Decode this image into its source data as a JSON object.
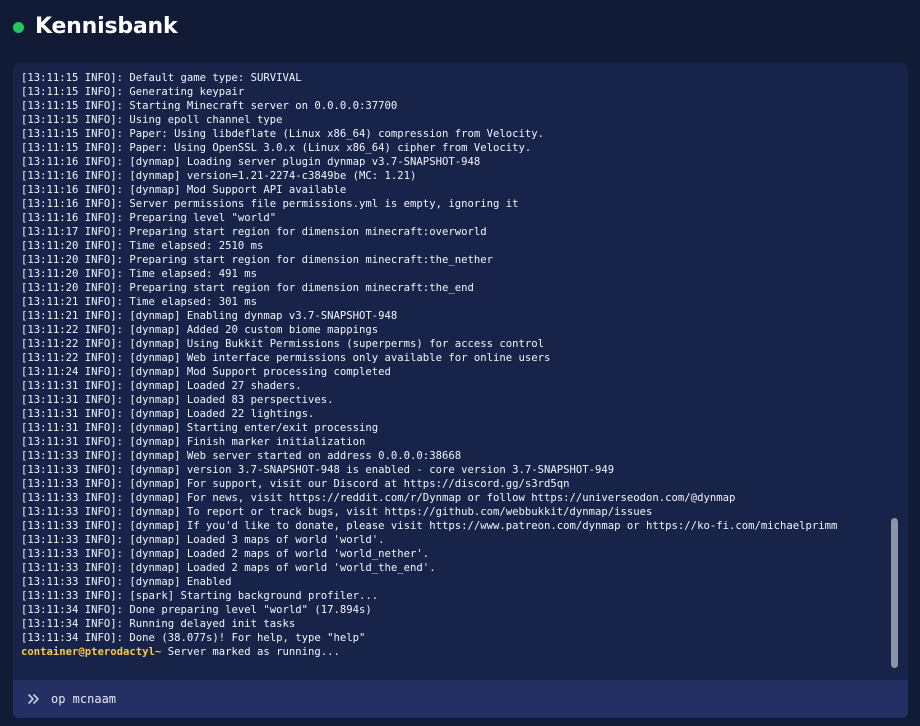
{
  "header": {
    "server_name": "Kennisbank",
    "status_color": "#22c55e"
  },
  "console": {
    "lines": [
      "[13:11:15 INFO]: Default game type: SURVIVAL",
      "[13:11:15 INFO]: Generating keypair",
      "[13:11:15 INFO]: Starting Minecraft server on 0.0.0.0:37700",
      "[13:11:15 INFO]: Using epoll channel type",
      "[13:11:15 INFO]: Paper: Using libdeflate (Linux x86_64) compression from Velocity.",
      "[13:11:15 INFO]: Paper: Using OpenSSL 3.0.x (Linux x86_64) cipher from Velocity.",
      "[13:11:16 INFO]: [dynmap] Loading server plugin dynmap v3.7-SNAPSHOT-948",
      "[13:11:16 INFO]: [dynmap] version=1.21-2274-c3849be (MC: 1.21)",
      "[13:11:16 INFO]: [dynmap] Mod Support API available",
      "[13:11:16 INFO]: Server permissions file permissions.yml is empty, ignoring it",
      "[13:11:16 INFO]: Preparing level \"world\"",
      "[13:11:17 INFO]: Preparing start region for dimension minecraft:overworld",
      "[13:11:20 INFO]: Time elapsed: 2510 ms",
      "[13:11:20 INFO]: Preparing start region for dimension minecraft:the_nether",
      "[13:11:20 INFO]: Time elapsed: 491 ms",
      "[13:11:20 INFO]: Preparing start region for dimension minecraft:the_end",
      "[13:11:21 INFO]: Time elapsed: 301 ms",
      "[13:11:21 INFO]: [dynmap] Enabling dynmap v3.7-SNAPSHOT-948",
      "[13:11:22 INFO]: [dynmap] Added 20 custom biome mappings",
      "[13:11:22 INFO]: [dynmap] Using Bukkit Permissions (superperms) for access control",
      "[13:11:22 INFO]: [dynmap] Web interface permissions only available for online users",
      "[13:11:24 INFO]: [dynmap] Mod Support processing completed",
      "[13:11:31 INFO]: [dynmap] Loaded 27 shaders.",
      "[13:11:31 INFO]: [dynmap] Loaded 83 perspectives.",
      "[13:11:31 INFO]: [dynmap] Loaded 22 lightings.",
      "[13:11:31 INFO]: [dynmap] Starting enter/exit processing",
      "[13:11:31 INFO]: [dynmap] Finish marker initialization",
      "[13:11:33 INFO]: [dynmap] Web server started on address 0.0.0.0:38668",
      "[13:11:33 INFO]: [dynmap] version 3.7-SNAPSHOT-948 is enabled - core version 3.7-SNAPSHOT-949",
      "[13:11:33 INFO]: [dynmap] For support, visit our Discord at https://discord.gg/s3rd5qn",
      "[13:11:33 INFO]: [dynmap] For news, visit https://reddit.com/r/Dynmap or follow https://universeodon.com/@dynmap",
      "[13:11:33 INFO]: [dynmap] To report or track bugs, visit https://github.com/webbukkit/dynmap/issues",
      "[13:11:33 INFO]: [dynmap] If you'd like to donate, please visit https://www.patreon.com/dynmap or https://ko-fi.com/michaelprimm",
      "[13:11:33 INFO]: [dynmap] Loaded 3 maps of world 'world'.",
      "[13:11:33 INFO]: [dynmap] Loaded 2 maps of world 'world_nether'.",
      "[13:11:33 INFO]: [dynmap] Loaded 2 maps of world 'world_the_end'.",
      "[13:11:33 INFO]: [dynmap] Enabled",
      "[13:11:33 INFO]: [spark] Starting background profiler...",
      "[13:11:34 INFO]: Done preparing level \"world\" (17.894s)",
      "[13:11:34 INFO]: Running delayed init tasks",
      "[13:11:34 INFO]: Done (38.077s)! For help, type \"help\""
    ],
    "prompt": {
      "user": "container@pterodactyl~",
      "message": " Server marked as running..."
    },
    "scroll_position": 0.97
  },
  "command": {
    "icon": "chevron-double-right-icon",
    "value": "op mcnaam"
  }
}
